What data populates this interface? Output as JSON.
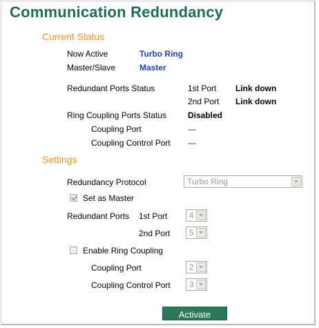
{
  "page": {
    "title": "Communication Redundancy"
  },
  "current_status": {
    "heading": "Current Status",
    "now_active_label": "Now Active",
    "now_active_value": "Turbo Ring",
    "master_slave_label": "Master/Slave",
    "master_slave_value": "Master",
    "redundant_ports_status_label": "Redundant Ports Status",
    "port1_label": "1st Port",
    "port1_value": "Link down",
    "port2_label": "2nd Port",
    "port2_value": "Link down",
    "ring_coupling_status_label": "Ring Coupling Ports Status",
    "ring_coupling_status_value": "Disabled",
    "coupling_port_label": "Coupling Port",
    "coupling_port_value": "---",
    "coupling_control_port_label": "Coupling Control Port",
    "coupling_control_port_value": "---"
  },
  "settings": {
    "heading": "Settings",
    "redundancy_protocol_label": "Redundancy Protocol",
    "redundancy_protocol_value": "Turbo Ring",
    "set_as_master_label": "Set as Master",
    "set_as_master_checked": true,
    "redundant_ports_label": "Redundant Ports",
    "first_port_label": "1st Port",
    "first_port_value": "4",
    "second_port_label": "2nd Port",
    "second_port_value": "5",
    "enable_ring_coupling_label": "Enable Ring Coupling",
    "enable_ring_coupling_checked": false,
    "coupling_port_label": "Coupling Port",
    "coupling_port_value": "2",
    "coupling_control_port_label": "Coupling Control Port",
    "coupling_control_port_value": "3",
    "activate_label": "Activate"
  },
  "colors": {
    "title": "#206a5a",
    "section_heading": "#f0901e",
    "active_value": "#1f3fbf",
    "button": "#2a7a5a"
  }
}
